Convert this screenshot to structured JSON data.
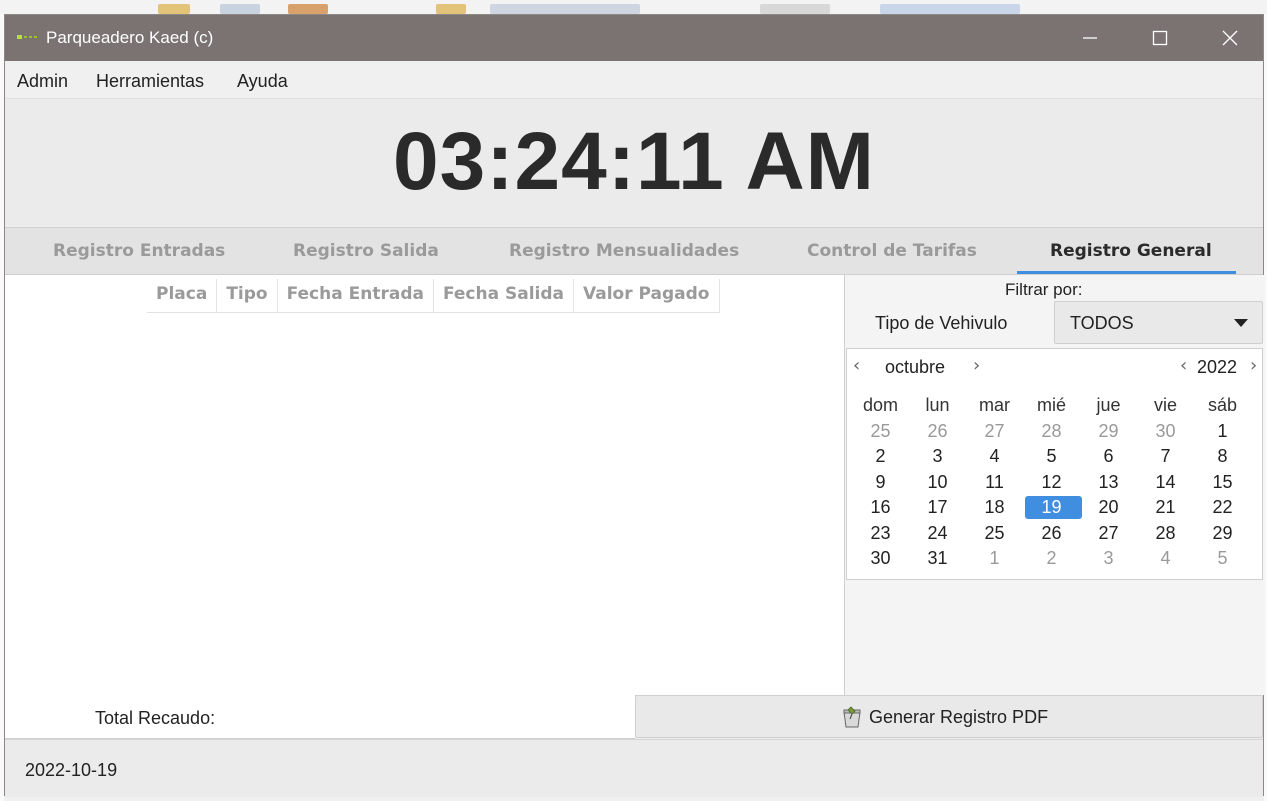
{
  "window": {
    "title": "Parqueadero Kaed (c)",
    "controls": {
      "minimize": "minimize-icon",
      "maximize": "maximize-icon",
      "close": "close-icon"
    }
  },
  "menu": {
    "items": [
      "Admin",
      "Herramientas",
      "Ayuda"
    ]
  },
  "clock": {
    "time": "03:24:11 AM"
  },
  "tabs": {
    "items": [
      "Registro Entradas",
      "Registro Salida",
      "Registro Mensualidades",
      "Control de Tarifas",
      "Registro General"
    ],
    "active": "Registro General",
    "accent_color": "#3f8ee0"
  },
  "table": {
    "columns": [
      "Placa",
      "Tipo",
      "Fecha Entrada",
      "Fecha Salida",
      "Valor Pagado"
    ],
    "rows": []
  },
  "filter": {
    "title": "Filtrar por:",
    "vehicle_type_label": "Tipo de Vehivulo",
    "vehicle_type_value": "TODOS"
  },
  "calendar": {
    "month": "octubre",
    "year": "2022",
    "weekdays": [
      "dom",
      "lun",
      "mar",
      "mié",
      "jue",
      "vie",
      "sáb"
    ],
    "weeks": [
      [
        {
          "d": "25",
          "dim": true
        },
        {
          "d": "26",
          "dim": true
        },
        {
          "d": "27",
          "dim": true
        },
        {
          "d": "28",
          "dim": true
        },
        {
          "d": "29",
          "dim": true
        },
        {
          "d": "30",
          "dim": true
        },
        {
          "d": "1"
        }
      ],
      [
        {
          "d": "2"
        },
        {
          "d": "3"
        },
        {
          "d": "4"
        },
        {
          "d": "5"
        },
        {
          "d": "6"
        },
        {
          "d": "7"
        },
        {
          "d": "8"
        }
      ],
      [
        {
          "d": "9"
        },
        {
          "d": "10"
        },
        {
          "d": "11"
        },
        {
          "d": "12"
        },
        {
          "d": "13"
        },
        {
          "d": "14"
        },
        {
          "d": "15"
        }
      ],
      [
        {
          "d": "16"
        },
        {
          "d": "17"
        },
        {
          "d": "18"
        },
        {
          "d": "19",
          "sel": true
        },
        {
          "d": "20"
        },
        {
          "d": "21"
        },
        {
          "d": "22"
        }
      ],
      [
        {
          "d": "23"
        },
        {
          "d": "24"
        },
        {
          "d": "25"
        },
        {
          "d": "26"
        },
        {
          "d": "27"
        },
        {
          "d": "28"
        },
        {
          "d": "29"
        }
      ],
      [
        {
          "d": "30"
        },
        {
          "d": "31"
        },
        {
          "d": "1",
          "dim": true
        },
        {
          "d": "2",
          "dim": true
        },
        {
          "d": "3",
          "dim": true
        },
        {
          "d": "4",
          "dim": true
        },
        {
          "d": "5",
          "dim": true
        }
      ]
    ],
    "selected_day": "19"
  },
  "footer": {
    "total_label": "Total Recaudo:",
    "pdf_button_label": "Generar Registro PDF",
    "pdf_button_icon": "pdf-export-icon",
    "status_date": "2022-10-19"
  }
}
